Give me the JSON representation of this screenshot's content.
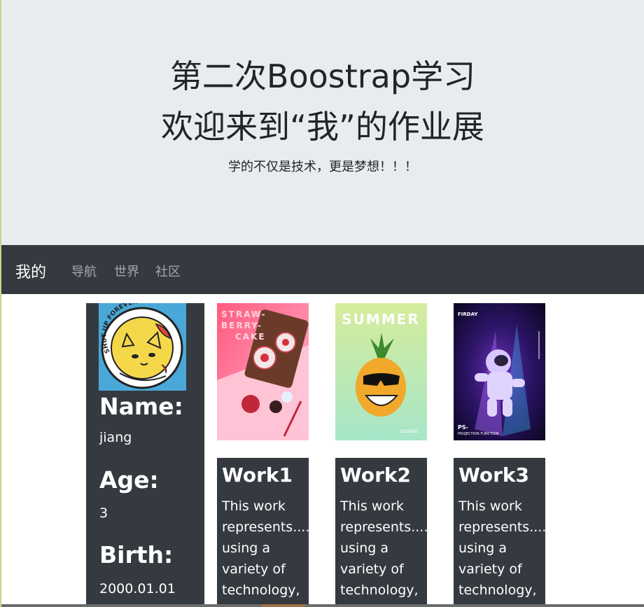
{
  "jumbotron": {
    "title_line1": "第二次Boostrap学习",
    "title_line2": "欢迎来到“我”的作业展",
    "subtitle": "学的不仅是技术，更是梦想！！！"
  },
  "navbar": {
    "brand": "我的",
    "links": [
      "导航",
      "世界",
      "社区"
    ]
  },
  "profile": {
    "avatar_text": "SHUT UP FOREVER",
    "fields": [
      {
        "label": "Name:",
        "value": "jiang"
      },
      {
        "label": "Age:",
        "value": "3"
      },
      {
        "label": "Birth:",
        "value": "2000.01.01"
      }
    ]
  },
  "posters": [
    {
      "text_lines": [
        "STRAW-",
        "BERRY-",
        "CAKE"
      ],
      "colors": [
        "#ff5a7e",
        "#ffb6cf"
      ]
    },
    {
      "text": "SUMMER",
      "footer": "QUSENG",
      "colors": [
        "#d6ec9c",
        "#a6e6c8"
      ]
    },
    {
      "header": "FIRDAY",
      "footer": "PS-",
      "footer_sub": "PROJECTION FUNCTION",
      "colors": [
        "#0b0620",
        "#6b2fb5"
      ]
    }
  ],
  "works": [
    {
      "title": "Work1",
      "text": "This work represents......, using a variety of technology,"
    },
    {
      "title": "Work2",
      "text": "This work represents......, using a variety of technology,"
    },
    {
      "title": "Work3",
      "text": "This work represents......, using a variety of technology,"
    }
  ]
}
